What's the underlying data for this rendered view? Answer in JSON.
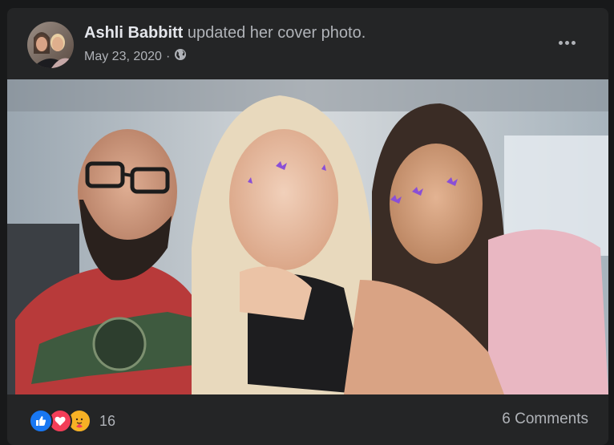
{
  "post": {
    "author_name": "Ashli Babbitt",
    "action_text": "updated her cover photo.",
    "date": "May 23, 2020",
    "separator": "·",
    "privacy_icon": "globe-icon"
  },
  "reactions": {
    "icons": [
      "like-icon",
      "love-icon",
      "care-icon"
    ],
    "count": "16"
  },
  "comments": {
    "label": "6 Comments"
  },
  "colors": {
    "background": "#18191a",
    "card": "#242526",
    "primary_text": "#e4e6eb",
    "secondary_text": "#b0b3b8",
    "like_blue": "#1877f2",
    "love_red": "#f33e58",
    "care_yellow": "#f7b125"
  }
}
